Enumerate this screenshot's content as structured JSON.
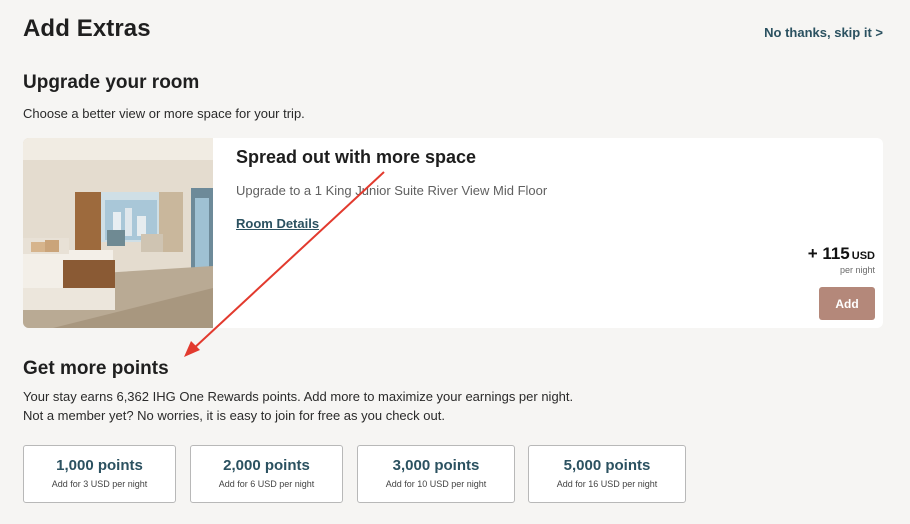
{
  "header": {
    "title": "Add Extras",
    "skip_label": "No thanks, skip it >"
  },
  "upgrade": {
    "heading": "Upgrade your room",
    "description": "Choose a better view or more space for your trip.",
    "card": {
      "title": "Spread out with more space",
      "subtitle": "Upgrade to a 1 King Junior Suite River View Mid Floor",
      "details_link": "Room Details",
      "price": "+ 115",
      "currency": "USD",
      "price_unit": "per night",
      "add_label": "Add"
    }
  },
  "points": {
    "heading": "Get more points",
    "desc_line1": "Your stay earns 6,362 IHG One Rewards points. Add more to maximize your earnings per night.",
    "desc_line2": "Not a member yet? No worries, it is easy to join for free as you check out.",
    "options": [
      {
        "label": "1,000 points",
        "price": "Add for 3 USD per night"
      },
      {
        "label": "2,000 points",
        "price": "Add for 6 USD per night"
      },
      {
        "label": "3,000 points",
        "price": "Add for 10 USD per night"
      },
      {
        "label": "5,000 points",
        "price": "Add for 16 USD per night"
      }
    ]
  },
  "colors": {
    "page_bg": "#f6f5f3",
    "link": "#2b5160",
    "add_button": "#b4887a",
    "annotation": "#e23a2e"
  },
  "icons": {
    "annotation": "red-arrow-annotation"
  }
}
